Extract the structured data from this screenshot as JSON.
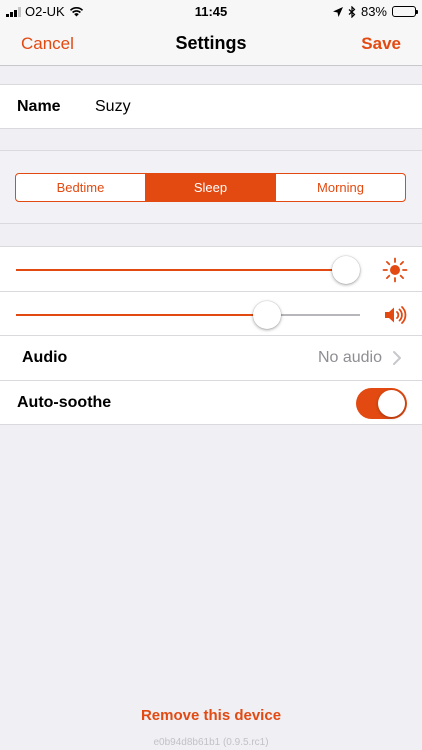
{
  "status": {
    "carrier": "O2-UK",
    "time": "11:45",
    "battery": "83%",
    "battery_level": 0.83
  },
  "nav": {
    "cancel_label": "Cancel",
    "title": "Settings",
    "save_label": "Save"
  },
  "name": {
    "label": "Name",
    "value": "Suzy"
  },
  "modes": {
    "options": [
      "Bedtime",
      "Sleep",
      "Morning"
    ],
    "selected": "Sleep"
  },
  "brightness_slider": {
    "value": 0.96,
    "icon": "sun-icon"
  },
  "volume_slider": {
    "value": 0.73,
    "icon": "speaker-icon"
  },
  "audio": {
    "label": "Audio",
    "value": "No audio"
  },
  "auto_soothe": {
    "label": "Auto-soothe",
    "enabled": true
  },
  "footer": {
    "remove_label": "Remove this device",
    "device_id": "e0b94d8b61b1 (0.9.5.rc1)"
  },
  "colors": {
    "accent": "#e24a12",
    "background": "#efeff4",
    "secondary_text": "#8e8e93"
  }
}
